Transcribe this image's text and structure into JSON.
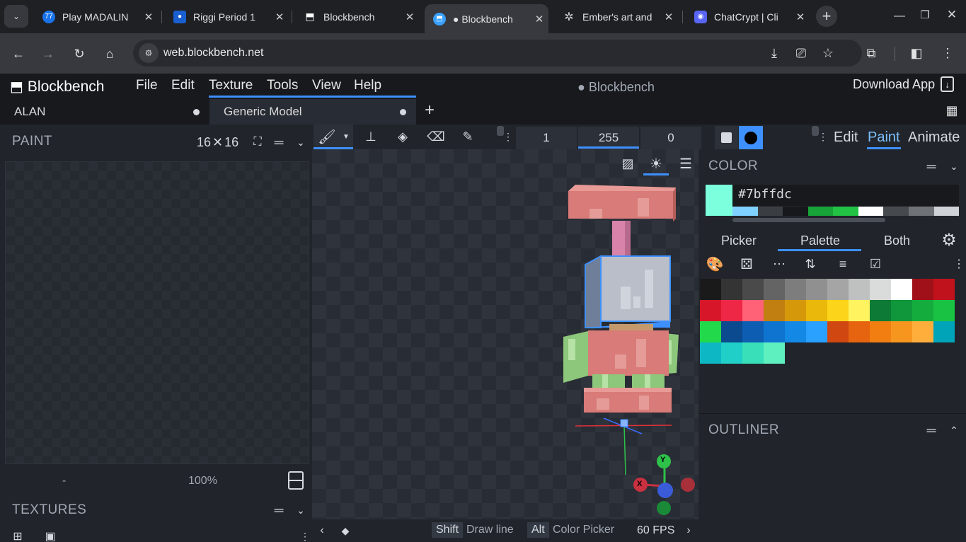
{
  "browser": {
    "tabs": [
      {
        "title": "Play MADALIN",
        "favicon": "77",
        "favicon_color": "#1a73e8"
      },
      {
        "title": "Riggi Period 1",
        "favicon": "",
        "favicon_color": "#1a5fd1"
      },
      {
        "title": "Blockbench",
        "favicon": "",
        "favicon_color": "#ffffff"
      },
      {
        "title": "● Blockbench",
        "favicon": "",
        "favicon_color": "#3aa0ff"
      },
      {
        "title": "Ember's art and",
        "favicon": "",
        "favicon_color": "#cccccc"
      },
      {
        "title": "ChatCrypt | Cli",
        "favicon": "",
        "favicon_color": "#5865f2"
      }
    ],
    "url": "web.blockbench.net"
  },
  "app": {
    "logo": "Blockbench",
    "menu": [
      "File",
      "Edit",
      "Texture",
      "Tools",
      "View",
      "Help"
    ],
    "window_title": "● Blockbench",
    "download_app": "Download App",
    "project_tabs": [
      {
        "label": "ALAN"
      },
      {
        "label": "Generic Model"
      }
    ]
  },
  "paint_panel": {
    "title": "PAINT",
    "size": "16",
    "size2": "16",
    "zoom_left": "-",
    "zoom": "100%"
  },
  "textures_panel": {
    "title": "TEXTURES"
  },
  "toolbar": {
    "values": [
      "1",
      "255",
      "0"
    ],
    "modes": [
      "Edit",
      "Paint",
      "Animate"
    ]
  },
  "color_panel": {
    "title": "COLOR",
    "hex": "#7bffdc",
    "current_color": "#7bffdc",
    "tabs": [
      "Picker",
      "Palette",
      "Both"
    ],
    "history": [
      "#7fd1ff",
      "#3a3d42",
      "#16181b",
      "#17a438",
      "#22c244",
      "#ffffff",
      "#46494e",
      "#6f7277",
      "#cfd2d6"
    ],
    "palette": [
      "#1a1a1a",
      "#343434",
      "#4a4a4a",
      "#646464",
      "#7d7d7d",
      "#909090",
      "#a5a5a5",
      "#bfc1c1",
      "#dadcdc",
      "#ffffff",
      "#a01018",
      "#c0121c",
      "#d8162a",
      "#ee2746",
      "#ff6176",
      "#c07f10",
      "#d6980b",
      "#eab80a",
      "#fcd41a",
      "#fff360",
      "#0d7a35",
      "#10973c",
      "#14ad3d",
      "#1ac244",
      "#22d94c",
      "#0b4a8f",
      "#0d5eb3",
      "#0f74d0",
      "#1388e5",
      "#2aa0ff",
      "#d04712",
      "#e66410",
      "#f27e12",
      "#f7961f",
      "#ffae3c",
      "#00a4b8",
      "#0db8c4",
      "#1fcfc8",
      "#38dfb8",
      "#5ff0c0"
    ]
  },
  "outliner": {
    "title": "OUTLINER"
  },
  "status": {
    "shift_key": "Shift",
    "shift_action": "Draw line",
    "alt_key": "Alt",
    "alt_action": "Color Picker",
    "fps": "60 FPS"
  },
  "gizmo": {
    "y": "Y",
    "x": "X"
  }
}
